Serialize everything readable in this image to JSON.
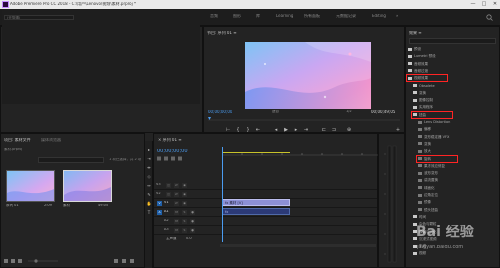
{
  "window": {
    "title": "Adobe Premiere Pro CC 2018 - C:\\用户\\Lenovo\\视频\\素材.prproj *",
    "minimize": "—",
    "maximize": "□",
    "close": "✕"
  },
  "workspaces": [
    "学习",
    "组件",
    "编辑",
    "颜色",
    "效果",
    "音频",
    "图形",
    "库",
    "Learning",
    "所有面板",
    "元数据记录",
    "Editing"
  ],
  "source_panel": {
    "tabs": [
      "效果控件",
      "Lumetri 范围",
      "源: (无剪辑)",
      "音频剪辑混合器: 序列"
    ],
    "field": "(无剪辑)"
  },
  "program_panel": {
    "title": "节目: 序列 01 ≡",
    "time_left": "00;00;00;00",
    "fit": "适合",
    "scale": "1/2",
    "time_right": "00;00;49;05",
    "controls": [
      "⊢",
      "{",
      "}",
      "⇤",
      "◂",
      "▶",
      "▸",
      "⇥",
      "⊏",
      "⊐",
      "⊕",
      "+"
    ]
  },
  "project_panel": {
    "tabs": [
      "项目: 素材文件",
      "媒体浏览器"
    ],
    "file": "素材.prproj",
    "count": "1 项已选择，共 2 项",
    "search_placeholder": "",
    "items": [
      {
        "name": "序列 01",
        "duration": "2:09"
      },
      {
        "name": "素材",
        "duration": "49:05"
      }
    ]
  },
  "timeline": {
    "title": "× 序列 01 ≡",
    "time": "00;00;00;00",
    "tracks": [
      {
        "name": "V3"
      },
      {
        "name": "V2"
      },
      {
        "name": "V1"
      },
      {
        "name": "A1"
      },
      {
        "name": "A2"
      },
      {
        "name": "A3"
      }
    ],
    "master": "主声道",
    "master_value": "0.0",
    "clip_video": "fx 素材 [V]",
    "clip_audio": "fx"
  },
  "effects_panel": {
    "title": "效果 ≡",
    "items": [
      {
        "label": "预设",
        "type": "folder",
        "indent": 0
      },
      {
        "label": "Lumetri 预设",
        "type": "folder",
        "indent": 0
      },
      {
        "label": "音频效果",
        "type": "folder",
        "indent": 0
      },
      {
        "label": "音频过渡",
        "type": "folder",
        "indent": 0
      },
      {
        "label": "视频效果",
        "type": "folder",
        "indent": 0,
        "highlight": true
      },
      {
        "label": "Obsolete",
        "type": "folder",
        "indent": 1
      },
      {
        "label": "变换",
        "type": "folder",
        "indent": 1
      },
      {
        "label": "图像控制",
        "type": "folder",
        "indent": 1
      },
      {
        "label": "实用程序",
        "type": "folder",
        "indent": 1
      },
      {
        "label": "扭曲",
        "type": "folder",
        "indent": 1,
        "highlight": true
      },
      {
        "label": "Lens Distortion",
        "type": "file",
        "indent": 2
      },
      {
        "label": "偏移",
        "type": "file",
        "indent": 2
      },
      {
        "label": "变形稳定器 VFX",
        "type": "file",
        "indent": 2
      },
      {
        "label": "变换",
        "type": "file",
        "indent": 2
      },
      {
        "label": "放大",
        "type": "file",
        "indent": 2
      },
      {
        "label": "旋转",
        "type": "file",
        "indent": 2,
        "highlight": true
      },
      {
        "label": "果冻效应修复",
        "type": "file",
        "indent": 2
      },
      {
        "label": "波形变形",
        "type": "file",
        "indent": 2
      },
      {
        "label": "湍流置换",
        "type": "file",
        "indent": 2
      },
      {
        "label": "球面化",
        "type": "file",
        "indent": 2
      },
      {
        "label": "边角定位",
        "type": "file",
        "indent": 2
      },
      {
        "label": "镜像",
        "type": "file",
        "indent": 2
      },
      {
        "label": "镜头扭曲",
        "type": "file",
        "indent": 2
      },
      {
        "label": "时间",
        "type": "folder",
        "indent": 1
      },
      {
        "label": "杂色与颗粒",
        "type": "folder",
        "indent": 1
      },
      {
        "label": "模糊与锐化",
        "type": "folder",
        "indent": 1
      },
      {
        "label": "沉浸式视频",
        "type": "folder",
        "indent": 1
      },
      {
        "label": "生成",
        "type": "folder",
        "indent": 1
      },
      {
        "label": "视频",
        "type": "folder",
        "indent": 1
      }
    ]
  },
  "watermark": {
    "brand": "Bai 经验",
    "url": "jingyan.baidu.com"
  }
}
